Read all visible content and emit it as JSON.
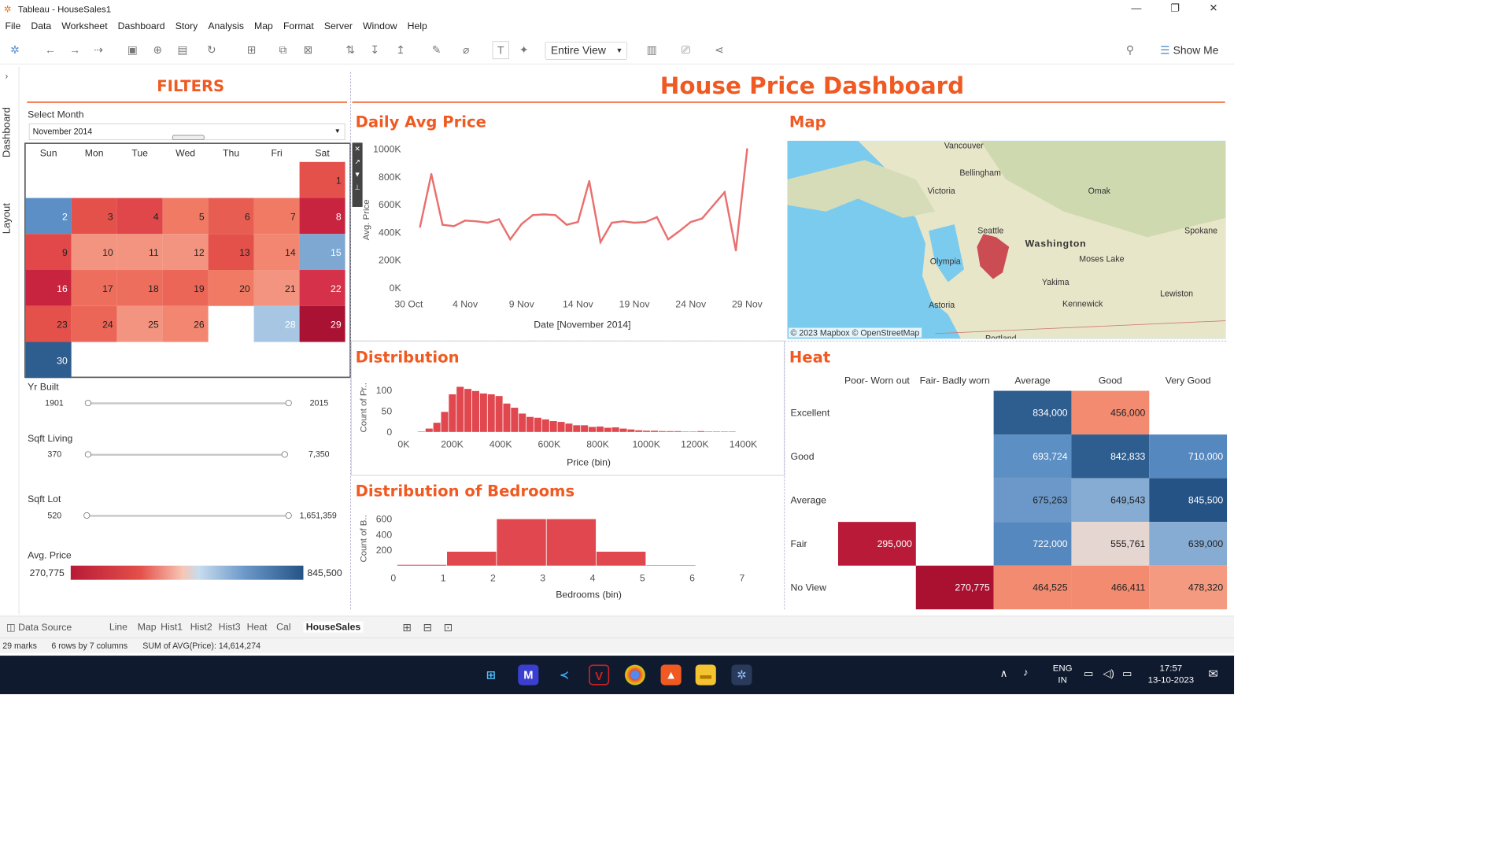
{
  "window": {
    "title": "Tableau - HouseSales1"
  },
  "menu": [
    "File",
    "Data",
    "Worksheet",
    "Dashboard",
    "Story",
    "Analysis",
    "Map",
    "Format",
    "Server",
    "Window",
    "Help"
  ],
  "toolbar": {
    "fit": "Entire View",
    "show_me": "Show Me"
  },
  "side_tabs": {
    "dashboard": "Dashboard",
    "layout": "Layout"
  },
  "dashboard_title": "House Price Dashboard",
  "filters": {
    "title": "FILTERS",
    "select_month_label": "Select Month",
    "month_value": "November 2014",
    "yr_built": {
      "label": "Yr Built",
      "min": "1901",
      "max": "2015"
    },
    "sqft_living": {
      "label": "Sqft Living",
      "min": "370",
      "max": "7,350"
    },
    "sqft_lot": {
      "label": "Sqft Lot",
      "min": "520",
      "max": "1,651,359"
    },
    "avg_price": {
      "label": "Avg. Price",
      "min": "270,775",
      "max": "845,500"
    }
  },
  "calendar": {
    "days": [
      "Sun",
      "Mon",
      "Tue",
      "Wed",
      "Thu",
      "Fri",
      "Sat"
    ],
    "cells": [
      {
        "d": "1",
        "col": 6,
        "row": 0,
        "color": "#e4504a"
      },
      {
        "d": "2",
        "col": 0,
        "row": 1,
        "color": "#5b8fc6"
      },
      {
        "d": "3",
        "col": 1,
        "row": 1,
        "color": "#e4504a"
      },
      {
        "d": "4",
        "col": 2,
        "row": 1,
        "color": "#e0474a"
      },
      {
        "d": "5",
        "col": 3,
        "row": 1,
        "color": "#f07a64"
      },
      {
        "d": "6",
        "col": 4,
        "row": 1,
        "color": "#e75d52"
      },
      {
        "d": "7",
        "col": 5,
        "row": 1,
        "color": "#f07a64"
      },
      {
        "d": "8",
        "col": 6,
        "row": 1,
        "color": "#c8243f"
      },
      {
        "d": "9",
        "col": 0,
        "row": 2,
        "color": "#e2484a"
      },
      {
        "d": "10",
        "col": 1,
        "row": 2,
        "color": "#f39480"
      },
      {
        "d": "11",
        "col": 2,
        "row": 2,
        "color": "#f39480"
      },
      {
        "d": "12",
        "col": 3,
        "row": 2,
        "color": "#f39480"
      },
      {
        "d": "13",
        "col": 4,
        "row": 2,
        "color": "#e4504a"
      },
      {
        "d": "14",
        "col": 5,
        "row": 2,
        "color": "#f28670"
      },
      {
        "d": "15",
        "col": 6,
        "row": 2,
        "color": "#7ea8d2"
      },
      {
        "d": "16",
        "col": 0,
        "row": 3,
        "color": "#c8243f"
      },
      {
        "d": "17",
        "col": 1,
        "row": 3,
        "color": "#ee6e5d"
      },
      {
        "d": "18",
        "col": 2,
        "row": 3,
        "color": "#ee6e5d"
      },
      {
        "d": "19",
        "col": 3,
        "row": 3,
        "color": "#ec6658"
      },
      {
        "d": "20",
        "col": 4,
        "row": 3,
        "color": "#f07a64"
      },
      {
        "d": "21",
        "col": 5,
        "row": 3,
        "color": "#f39480"
      },
      {
        "d": "22",
        "col": 6,
        "row": 3,
        "color": "#d5314a"
      },
      {
        "d": "23",
        "col": 0,
        "row": 4,
        "color": "#e4504a"
      },
      {
        "d": "24",
        "col": 1,
        "row": 4,
        "color": "#ec6658"
      },
      {
        "d": "25",
        "col": 2,
        "row": 4,
        "color": "#f39480"
      },
      {
        "d": "26",
        "col": 3,
        "row": 4,
        "color": "#f28670"
      },
      {
        "d": "28",
        "col": 5,
        "row": 4,
        "color": "#a7c6e4"
      },
      {
        "d": "29",
        "col": 6,
        "row": 4,
        "color": "#a91232"
      },
      {
        "d": "30",
        "col": 0,
        "row": 5,
        "color": "#2e5d8f"
      }
    ]
  },
  "line_chart": {
    "title": "Daily Avg Price",
    "chart_data": {
      "type": "line",
      "xlabel": "Date [November 2014]",
      "ylabel": "Avg. Price",
      "ylim": [
        0,
        1000000
      ],
      "yticks": [
        "0K",
        "200K",
        "400K",
        "600K",
        "800K",
        "1000K"
      ],
      "xticks": [
        "30 Oct",
        "4 Nov",
        "9 Nov",
        "14 Nov",
        "19 Nov",
        "24 Nov",
        "29 Nov"
      ],
      "x": [
        1,
        2,
        3,
        4,
        5,
        6,
        7,
        8,
        9,
        10,
        11,
        12,
        13,
        14,
        15,
        16,
        17,
        18,
        19,
        20,
        21,
        22,
        23,
        24,
        25,
        26,
        28,
        29,
        30
      ],
      "values": [
        440000,
        820000,
        455000,
        445000,
        485000,
        480000,
        470000,
        495000,
        350000,
        460000,
        525000,
        530000,
        525000,
        455000,
        475000,
        770000,
        330000,
        470000,
        480000,
        470000,
        475000,
        510000,
        350000,
        410000,
        475000,
        500000,
        690000,
        270775,
        1000000
      ]
    }
  },
  "map": {
    "title": "Map",
    "attribution": "© 2023 Mapbox © OpenStreetMap",
    "labels": [
      "Vancouver",
      "Bellingham",
      "Victoria",
      "Omak",
      "Seattle",
      "Washington",
      "Spokane",
      "Olympia",
      "Moses Lake",
      "Yakima",
      "Astoria",
      "Kennewick",
      "Lewiston",
      "Portland"
    ]
  },
  "distribution": {
    "title": "Distribution",
    "chart_data": {
      "type": "bar",
      "xlabel": "Price (bin)",
      "ylabel": "Count of Pr..",
      "ylim": [
        0,
        120
      ],
      "yticks": [
        "0",
        "50",
        "100"
      ],
      "xticks": [
        "0K",
        "200K",
        "400K",
        "600K",
        "800K",
        "1000K",
        "1200K",
        "1400K"
      ],
      "values": [
        1,
        8,
        22,
        48,
        90,
        108,
        103,
        98,
        92,
        90,
        86,
        68,
        58,
        44,
        36,
        34,
        30,
        26,
        24,
        20,
        16,
        16,
        12,
        13,
        10,
        11,
        8,
        6,
        4,
        3,
        3,
        2,
        2,
        2,
        1,
        1,
        2,
        1,
        1,
        1,
        1
      ]
    }
  },
  "bedrooms": {
    "title": "Distribution of Bedrooms",
    "chart_data": {
      "type": "bar",
      "xlabel": "Bedrooms (bin)",
      "ylabel": "Count of B..",
      "categories": [
        "0",
        "1",
        "2",
        "3",
        "4",
        "5",
        "6",
        "7"
      ],
      "values": [
        10,
        180,
        600,
        600,
        180,
        5
      ],
      "bins": [
        [
          0,
          1
        ],
        [
          1,
          2
        ],
        [
          2,
          3
        ],
        [
          3,
          4
        ],
        [
          4,
          5
        ],
        [
          5,
          6
        ]
      ],
      "yticks": [
        "200",
        "400",
        "600"
      ],
      "ylim": [
        0,
        680
      ]
    }
  },
  "heat": {
    "title": "Heat",
    "columns": [
      "Poor- Worn out",
      "Fair- Badly worn",
      "Average",
      "Good",
      "Very Good"
    ],
    "rows": [
      "Excellent",
      "Good",
      "Average",
      "Fair",
      "No View"
    ],
    "cells": [
      {
        "r": 0,
        "c": 2,
        "v": "834,000",
        "color": "#2e5d8f",
        "fg": "#fff"
      },
      {
        "r": 0,
        "c": 3,
        "v": "456,000",
        "color": "#f28b70",
        "fg": "#222"
      },
      {
        "r": 1,
        "c": 2,
        "v": "693,724",
        "color": "#5c8fc3",
        "fg": "#fff"
      },
      {
        "r": 1,
        "c": 3,
        "v": "842,833",
        "color": "#2e5d8f",
        "fg": "#fff"
      },
      {
        "r": 1,
        "c": 4,
        "v": "710,000",
        "color": "#5488bf",
        "fg": "#fff"
      },
      {
        "r": 2,
        "c": 2,
        "v": "675,263",
        "color": "#6b98c9",
        "fg": "#222"
      },
      {
        "r": 2,
        "c": 3,
        "v": "649,543",
        "color": "#86acd3",
        "fg": "#222"
      },
      {
        "r": 2,
        "c": 4,
        "v": "845,500",
        "color": "#255386",
        "fg": "#fff"
      },
      {
        "r": 3,
        "c": 0,
        "v": "295,000",
        "color": "#b81a37",
        "fg": "#fff"
      },
      {
        "r": 3,
        "c": 2,
        "v": "722,000",
        "color": "#5488bf",
        "fg": "#fff"
      },
      {
        "r": 3,
        "c": 3,
        "v": "555,761",
        "color": "#e6d6d2",
        "fg": "#222"
      },
      {
        "r": 3,
        "c": 4,
        "v": "639,000",
        "color": "#86acd3",
        "fg": "#222"
      },
      {
        "r": 4,
        "c": 1,
        "v": "270,775",
        "color": "#aa1030",
        "fg": "#fff"
      },
      {
        "r": 4,
        "c": 2,
        "v": "464,525",
        "color": "#f28b70",
        "fg": "#222"
      },
      {
        "r": 4,
        "c": 3,
        "v": "466,411",
        "color": "#f28b70",
        "fg": "#222"
      },
      {
        "r": 4,
        "c": 4,
        "v": "478,320",
        "color": "#f39a80",
        "fg": "#222"
      }
    ]
  },
  "bottom_tabs": {
    "data_source": "Data Source",
    "sheets": [
      "Line",
      "Map",
      "Hist1",
      "Hist2",
      "Hist3",
      "Heat",
      "Cal",
      "HouseSales"
    ]
  },
  "status": {
    "marks": "29 marks",
    "dims": "6 rows by 7 columns",
    "sum": "SUM of AVG(Price): 14,614,274"
  },
  "taskbar": {
    "lang1": "ENG",
    "lang2": "IN",
    "time": "17:57",
    "date": "13-10-2023"
  }
}
